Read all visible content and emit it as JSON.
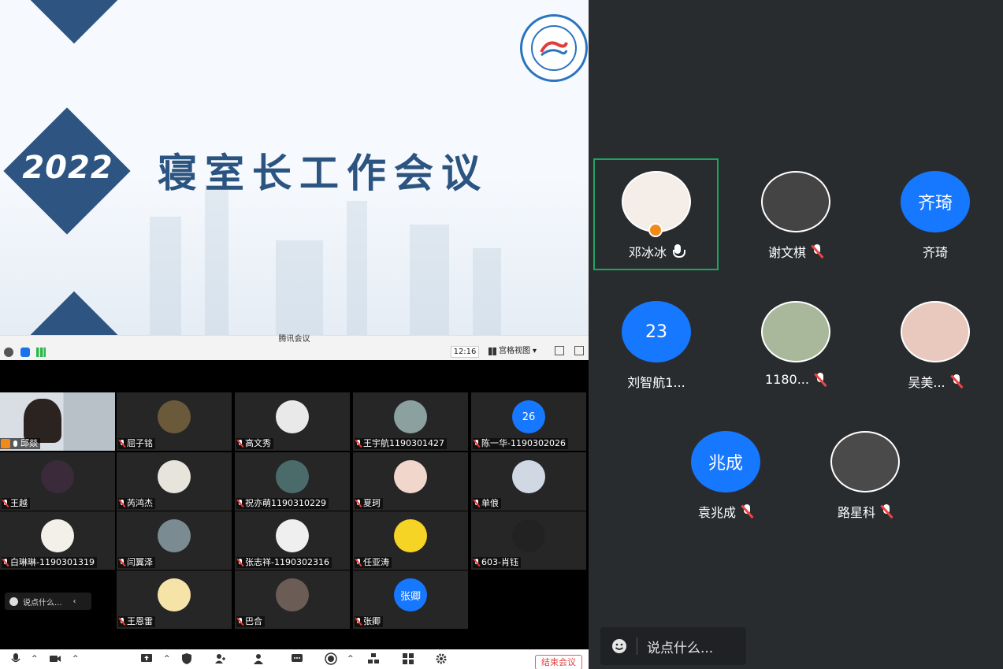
{
  "slide": {
    "year": "2022",
    "title": "寝室长工作会议"
  },
  "vm_bar": {
    "title": "腾讯会议",
    "clock": "12:16",
    "view_label": "宫格视图"
  },
  "grid": [
    {
      "name": "邱燚",
      "kind": "video"
    },
    {
      "name": "屈子铭"
    },
    {
      "name": "高文秀"
    },
    {
      "name": "王宇航1190301427"
    },
    {
      "name": "陈一华-1190302026",
      "badge": "26"
    },
    {
      "name": "王越"
    },
    {
      "name": "芮鸿杰"
    },
    {
      "name": "祝亦萌1190310229"
    },
    {
      "name": "夏珂"
    },
    {
      "name": "单俍"
    },
    {
      "name": "白琳琳-1190301319"
    },
    {
      "name": "闫翼泽"
    },
    {
      "name": "张志祥-1190302316"
    },
    {
      "name": "任亚涛"
    },
    {
      "name": "603-肖钰"
    },
    {
      "name": "王恩雷"
    },
    {
      "name": "巴合"
    },
    {
      "name": "张卿",
      "badge": "张卿"
    }
  ],
  "left_chat": {
    "placeholder": "说点什么..."
  },
  "toolbar": {
    "end_meeting": "结束会议"
  },
  "participants": [
    {
      "name": "邓冰冰",
      "mic": "on",
      "host": true
    },
    {
      "name": "谢文棋",
      "mic": "off"
    },
    {
      "name": "齐琦",
      "badge": "齐琦"
    },
    {
      "name": "刘智航1...",
      "badge": "23"
    },
    {
      "name": "1180...",
      "mic": "off"
    },
    {
      "name": "吴美...",
      "mic": "off"
    },
    {
      "name": "袁兆成",
      "mic": "off",
      "badge": "兆成"
    },
    {
      "name": "路星科",
      "mic": "off"
    }
  ],
  "right_chat": {
    "placeholder": "说点什么..."
  },
  "colors": {
    "accent_blue": "#1677ff",
    "host_frame": "#1aa760",
    "slide_navy": "#2e5481",
    "end_red": "#e04040"
  }
}
